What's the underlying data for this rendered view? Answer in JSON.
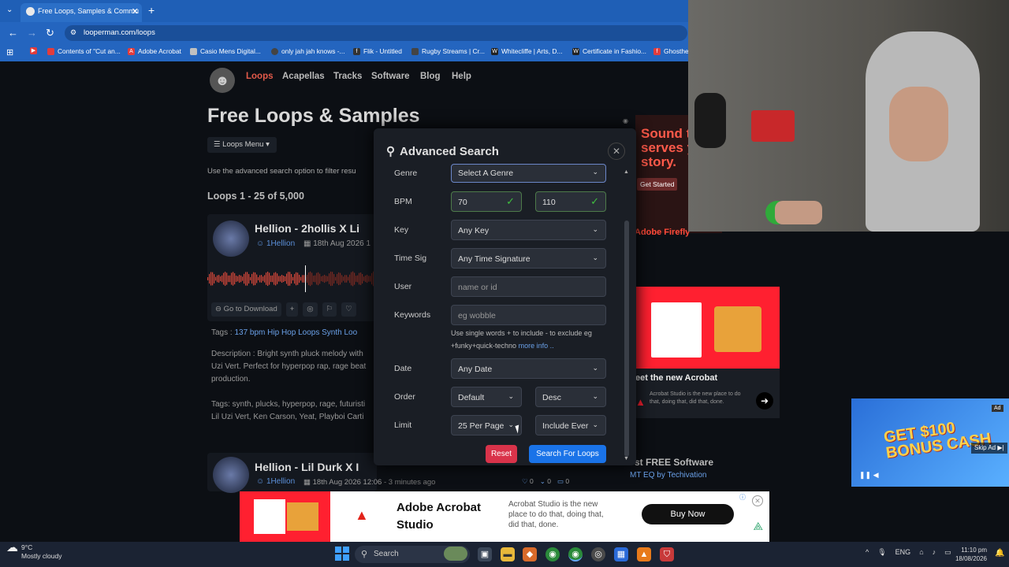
{
  "browser": {
    "tab_title": "Free Loops, Samples & Commu",
    "url": "looperman.com/loops",
    "bookmarks": [
      {
        "label": "Contents of \"Cut an...",
        "color": "#e23c3c"
      },
      {
        "label": "Adobe Acrobat",
        "color": "#e23c3c"
      },
      {
        "label": "Casio Mens Digital...",
        "color": "#c0c0c0"
      },
      {
        "label": "only jah jah knows -...",
        "color": "#444444"
      },
      {
        "label": "Flik - Untitled",
        "color": "#333333"
      },
      {
        "label": "Rugby Streams | Cr...",
        "color": "#444444"
      },
      {
        "label": "Whitecliffe | Arts, D...",
        "color": "#222222"
      },
      {
        "label": "Certificate in Fashio...",
        "color": "#222222"
      },
      {
        "label": "Ghosthe",
        "color": "#e23c3c"
      }
    ]
  },
  "site": {
    "nav": [
      "Loops",
      "Acapellas",
      "Tracks",
      "Software",
      "Blog",
      "Help"
    ],
    "title": "Free Loops & Samples",
    "loops_menu": "Loops Menu",
    "intro": "Use the advanced search option to filter resu",
    "count": "Loops 1 - 25 of 5,000",
    "accent": "#e35a4a"
  },
  "cards": [
    {
      "title": "Hellion - 2hollis X Li",
      "user": "1Hellion",
      "date": "18th Aug 2026 1",
      "download": "Go to Download",
      "tags_prefix": "Tags :",
      "tags": [
        "137 bpm",
        "Hip Hop Loops",
        "Synth Loo"
      ],
      "description": "Description : Bright synth pluck melody with",
      "description_2": "Uzi Vert. Perfect for hyperpop rap, rage beat",
      "description_3": "production.",
      "keywords": "Tags: synth, plucks, hyperpop, rage, futuristi",
      "keywords_2": "Lil Uzi Vert, Ken Carson, Yeat, Playboi Carti"
    },
    {
      "title": "Hellion - Lil Durk X I",
      "user": "1Hellion",
      "date": "18th Aug 2026 12:06",
      "ago": "- 3 minutes ago",
      "likes": "0",
      "downloads": "0",
      "comments": "0"
    }
  ],
  "modal": {
    "title": "Advanced Search",
    "fields": {
      "genre": {
        "label": "Genre",
        "value": "Select A Genre"
      },
      "bpm": {
        "label": "BPM",
        "min": "70",
        "max": "110"
      },
      "key": {
        "label": "Key",
        "value": "Any Key"
      },
      "timesig": {
        "label": "Time Sig",
        "value": "Any Time Signature"
      },
      "user": {
        "label": "User",
        "placeholder": "name or id"
      },
      "keywords": {
        "label": "Keywords",
        "placeholder": "eg wobble"
      },
      "date": {
        "label": "Date",
        "value": "Any Date"
      },
      "order": {
        "label": "Order",
        "value": "Default",
        "dir": "Desc"
      },
      "limit": {
        "label": "Limit",
        "value": "25 Per Page",
        "include": "Include Ever"
      }
    },
    "hint": "Use single words + to include - to exclude eg +funky+quick-techno",
    "hint_link": "more info ..",
    "reset": "Reset",
    "submit": "Search For Loops"
  },
  "ads": {
    "top_text": "Sound th serves yo story.",
    "top_cta": "Get Started",
    "top_brand": "Adobe Firefly",
    "mid_heading": "eet the new Acrobat",
    "mid_sub": "Acrobat Studio is the new place to do that, doing that, did that, done.",
    "best_software": "st FREE Software",
    "sw_prefix": "MT EQ by",
    "sw_author": "Techivation",
    "video_text": "GET $100 BONUS CASH",
    "skip": "Skip Ad",
    "ad_badge": "Ad",
    "bottom_title": "Adobe Acrobat Studio",
    "bottom_desc": "Acrobat Studio is the new place to do that, doing that, did that, done.",
    "bottom_cta": "Buy Now"
  },
  "taskbar": {
    "temp": "9°C",
    "weather": "Mostly cloudy",
    "search": "Search",
    "lang": "ENG",
    "time": "11:10 pm",
    "date": "18/08/2026"
  }
}
